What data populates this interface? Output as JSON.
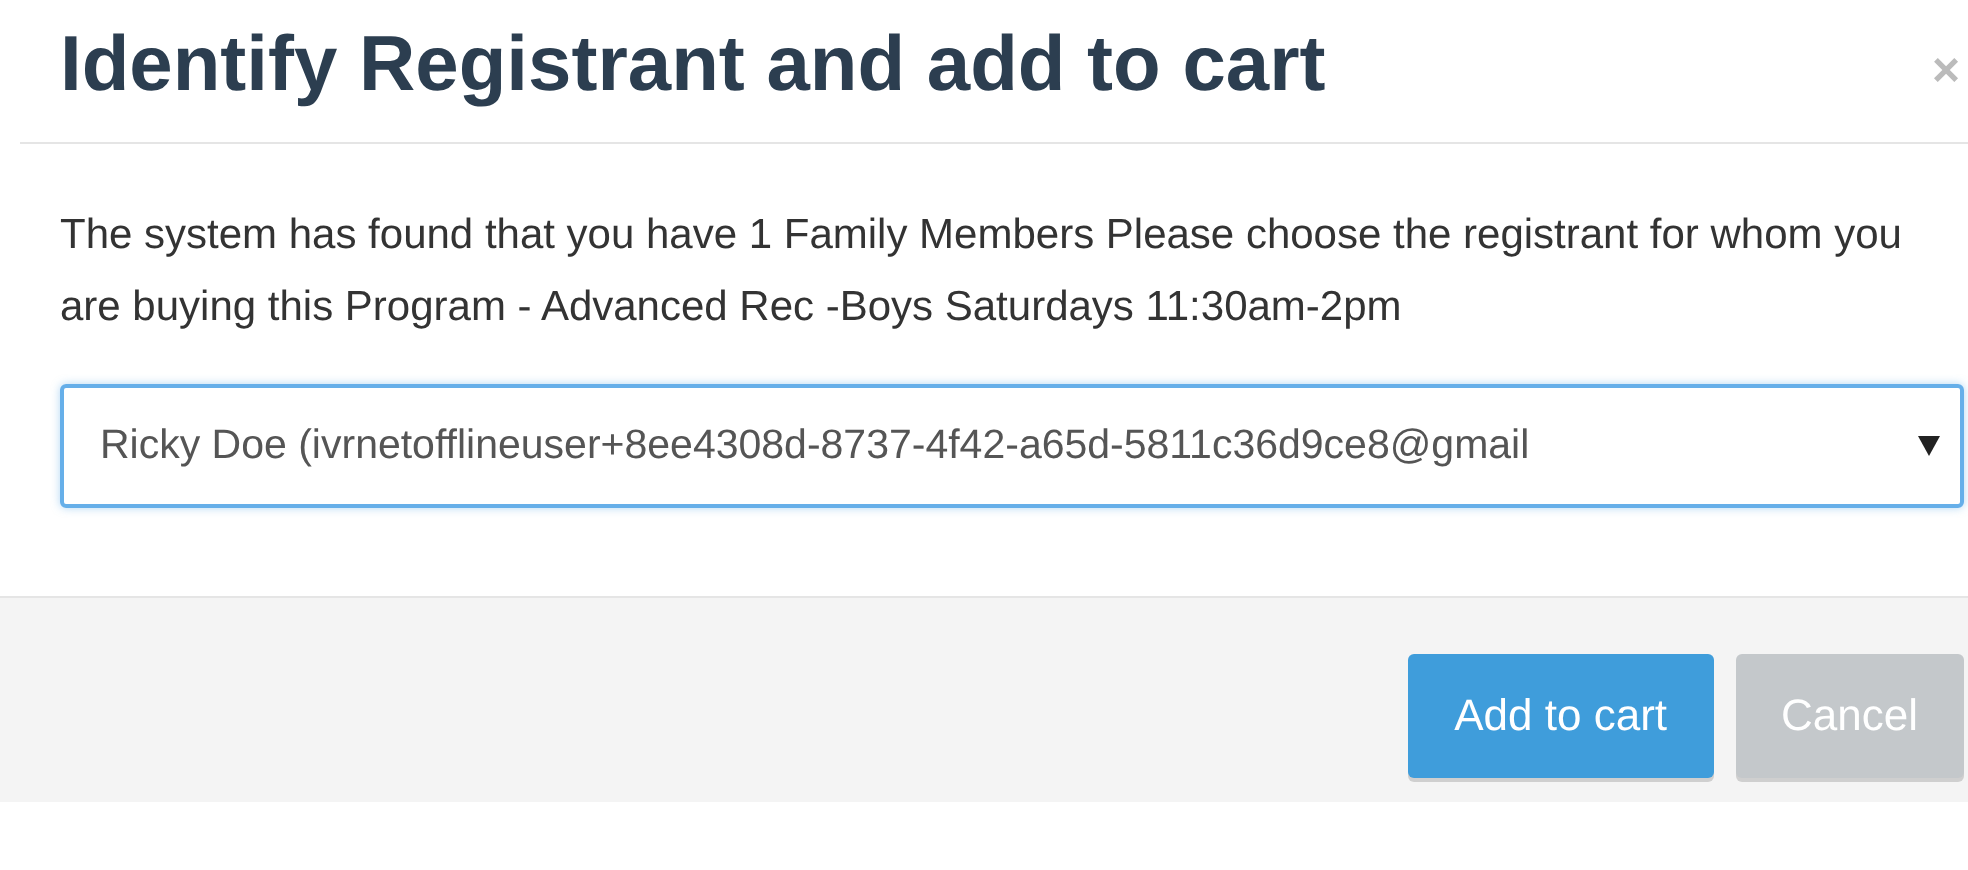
{
  "dialog": {
    "title": "Identify Registrant and add to cart",
    "close": "×"
  },
  "message": "The system has found that you have 1 Family Members Please choose the registrant for whom you are buying this Program - Advanced Rec -Boys Saturdays 11:30am-2pm",
  "registrant_select": {
    "value": "Ricky Doe (ivrnetofflineuser+8ee4308d-8737-4f42-a65d-5811c36d9ce8@gmail"
  },
  "buttons": [
    {
      "label": "Add to cart",
      "kind": "primary"
    },
    {
      "label": "Cancel",
      "kind": "secondary"
    }
  ]
}
